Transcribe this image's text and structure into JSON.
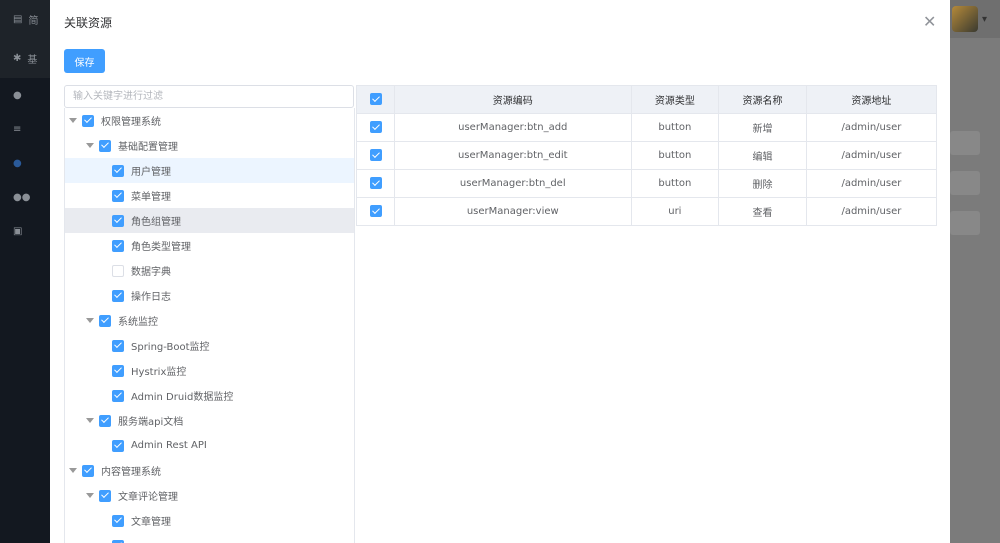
{
  "background": {
    "sidebar": [
      {
        "icon": "document-icon",
        "label": "简"
      },
      {
        "icon": "gear-icon",
        "label": "基"
      }
    ]
  },
  "modal": {
    "title": "关联资源",
    "save_label": "保存",
    "filter_placeholder": "输入关键字进行过滤"
  },
  "tree": [
    {
      "label": "权限管理系统",
      "level": 0,
      "checked": true,
      "expanded": true
    },
    {
      "label": "基础配置管理",
      "level": 1,
      "checked": true,
      "expanded": true
    },
    {
      "label": "用户管理",
      "level": 2,
      "checked": true,
      "state": "hl"
    },
    {
      "label": "菜单管理",
      "level": 2,
      "checked": true
    },
    {
      "label": "角色组管理",
      "level": 2,
      "checked": true,
      "state": "sel"
    },
    {
      "label": "角色类型管理",
      "level": 2,
      "checked": true
    },
    {
      "label": "数据字典",
      "level": 2,
      "checked": false
    },
    {
      "label": "操作日志",
      "level": 2,
      "checked": true
    },
    {
      "label": "系统监控",
      "level": 1,
      "checked": true,
      "expanded": true
    },
    {
      "label": "Spring-Boot监控",
      "level": 2,
      "checked": true
    },
    {
      "label": "Hystrix监控",
      "level": 2,
      "checked": true
    },
    {
      "label": "Admin Druid数据监控",
      "level": 2,
      "checked": true
    },
    {
      "label": "服务端api文档",
      "level": 1,
      "checked": true,
      "expanded": true
    },
    {
      "label": "Admin Rest API",
      "level": 2,
      "checked": true
    },
    {
      "label": "内容管理系统",
      "level": 0,
      "checked": true,
      "expanded": true
    },
    {
      "label": "文章评论管理",
      "level": 1,
      "checked": true,
      "expanded": true
    },
    {
      "label": "文章管理",
      "level": 2,
      "checked": true
    },
    {
      "label": "",
      "level": 2,
      "checked": true
    }
  ],
  "table": {
    "headers": [
      "资源编码",
      "资源类型",
      "资源名称",
      "资源地址"
    ],
    "rows": [
      [
        "userManager:btn_add",
        "button",
        "新增",
        "/admin/user"
      ],
      [
        "userManager:btn_edit",
        "button",
        "编辑",
        "/admin/user"
      ],
      [
        "userManager:btn_del",
        "button",
        "删除",
        "/admin/user"
      ],
      [
        "userManager:view",
        "uri",
        "查看",
        "/admin/user"
      ]
    ]
  }
}
